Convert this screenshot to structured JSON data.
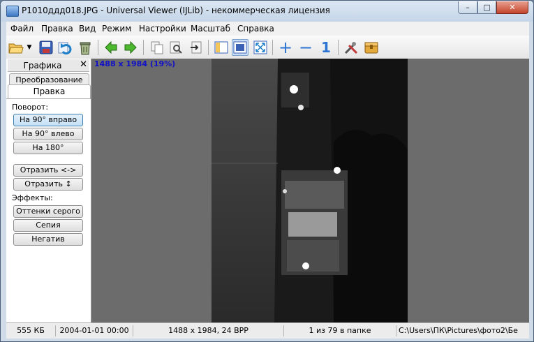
{
  "window": {
    "title": "P1010ддд018.JPG - Universal Viewer (IJLib) - некоммерческая лицензия",
    "min_glyph": "–",
    "max_glyph": "□",
    "close_glyph": "✕"
  },
  "menu": [
    "Файл",
    "Правка",
    "Вид",
    "Режим",
    "Настройки",
    "Масштаб",
    "Справка"
  ],
  "toolbar": {
    "icons": [
      "open-folder-icon",
      "dropdown-arrow-icon",
      "save-icon",
      "refresh-icon",
      "recycle-bin-icon",
      "arrow-left-icon",
      "arrow-right-icon",
      "copy-icon",
      "zoom-preview-icon",
      "move-to-icon",
      "panel-toggle-icon",
      "fit-window-icon",
      "fullscreen-icon",
      "zoom-in-icon",
      "zoom-out-icon",
      "actual-size-icon",
      "tools-icon",
      "package-icon"
    ],
    "zoom_in_glyph": "+",
    "zoom_out_glyph": "−",
    "actual_size_glyph": "1"
  },
  "panel": {
    "tab_label": "Графика",
    "close_glyph": "✕",
    "back_tab": "Преобразование",
    "front_tab": "Правка",
    "rotate_label": "Поворот:",
    "rotate_right": "На 90° вправо",
    "rotate_left": "На 90° влево",
    "rotate_180": "На 180°",
    "flip_h": "Отразить <->",
    "flip_v": "Отразить ↕",
    "effects_label": "Эффекты:",
    "grayscale": "Оттенки серого",
    "sepia": "Сепия",
    "negative": "Негатив"
  },
  "viewer": {
    "dimensions_overlay": "1488 x 1984 (19%)"
  },
  "status": {
    "size": "555 КБ",
    "date": "2004-01-01 00:00",
    "resolution": "1488 x 1984, 24 BPP",
    "position": "1 из 79 в папке",
    "path": "C:\\Users\\ПК\\Pictures\\фото2\\Бе"
  },
  "colors": {
    "titlebar": "#c4d5e8",
    "overlay_text": "#1010c8",
    "viewer_bg": "#6c6c6c"
  }
}
